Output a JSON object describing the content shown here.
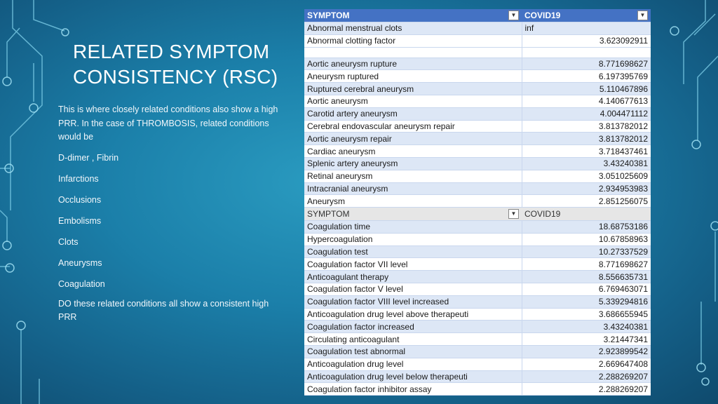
{
  "slide": {
    "title_line1": "RELATED SYMPTOM",
    "title_line2": "CONSISTENCY (RSC)",
    "intro": "This is where closely related conditions also show a high PRR. In the case of THROMBOSIS, related conditions would be",
    "items": [
      "D-dimer , Fibrin",
      "Infarctions",
      "Occlusions",
      "Embolisms",
      "Clots",
      "Aneurysms",
      "Coagulation"
    ],
    "closing": "DO these related conditions all show a consistent high PRR"
  },
  "table1": {
    "col_symptom": "SYMPTOM",
    "col_value": "COVID19",
    "filter_icon": "filter-dropdown-icon",
    "sort_icon": "sort-dropdown-icon",
    "top_rows": [
      {
        "symptom": "Abnormal menstrual clots",
        "value": "inf"
      },
      {
        "symptom": "Abnormal clotting factor",
        "value": "3.623092911"
      }
    ],
    "rows": [
      {
        "symptom": "Aortic aneurysm rupture",
        "value": "8.771698627"
      },
      {
        "symptom": "Aneurysm ruptured",
        "value": "6.197395769"
      },
      {
        "symptom": "Ruptured cerebral aneurysm",
        "value": "5.110467896"
      },
      {
        "symptom": "Aortic aneurysm",
        "value": "4.140677613"
      },
      {
        "symptom": "Carotid artery aneurysm",
        "value": "4.004471112"
      },
      {
        "symptom": "Cerebral endovascular aneurysm repair",
        "value": "3.813782012"
      },
      {
        "symptom": "Aortic aneurysm repair",
        "value": "3.813782012"
      },
      {
        "symptom": "Cardiac aneurysm",
        "value": "3.718437461"
      },
      {
        "symptom": "Splenic artery aneurysm",
        "value": "3.43240381"
      },
      {
        "symptom": "Retinal aneurysm",
        "value": "3.051025609"
      },
      {
        "symptom": "Intracranial aneurysm",
        "value": "2.934953983"
      },
      {
        "symptom": "Aneurysm",
        "value": "2.851256075"
      }
    ]
  },
  "table2": {
    "col_symptom": "SYMPTOM",
    "col_value": "COVID19",
    "rows": [
      {
        "symptom": "Coagulation time",
        "value": "18.68753186"
      },
      {
        "symptom": "Hypercoagulation",
        "value": "10.67858963"
      },
      {
        "symptom": "Coagulation test",
        "value": "10.27337529"
      },
      {
        "symptom": "Coagulation factor VII level",
        "value": "8.771698627"
      },
      {
        "symptom": "Anticoagulant therapy",
        "value": "8.556635731"
      },
      {
        "symptom": "Coagulation factor V level",
        "value": "6.769463071"
      },
      {
        "symptom": "Coagulation factor VIII level increased",
        "value": "5.339294816"
      },
      {
        "symptom": "Anticoagulation drug level above therapeuti",
        "value": "3.686655945"
      },
      {
        "symptom": "Coagulation factor increased",
        "value": "3.43240381"
      },
      {
        "symptom": "Circulating anticoagulant",
        "value": "3.21447341"
      },
      {
        "symptom": "Coagulation test abnormal",
        "value": "2.923899542"
      },
      {
        "symptom": "Anticoagulation drug level",
        "value": "2.669647408"
      },
      {
        "symptom": "Anticoagulation drug level below therapeuti",
        "value": "2.288269207"
      },
      {
        "symptom": "Coagulation factor inhibitor assay",
        "value": "2.288269207"
      }
    ]
  }
}
